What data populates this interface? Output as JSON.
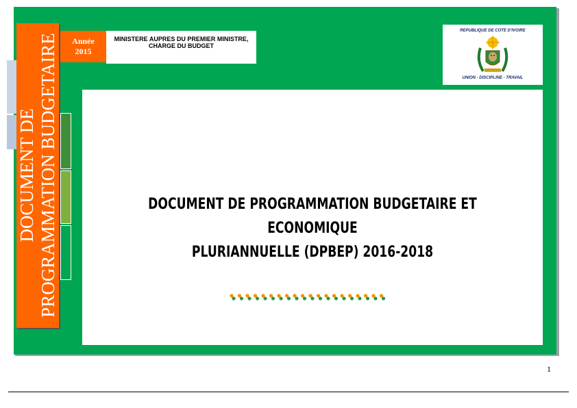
{
  "cover": {
    "vertical_title": "DOCUMENT DE PROGRAMMATION BUDGETAIRE",
    "year_label": "Année",
    "year_value": "2015",
    "ministry_line1": "MINISTERE AUPRES DU PREMIER MINISTRE,",
    "ministry_line2": "CHARGE DU BUDGET",
    "republic": "REPUBLIQUE DE COTE D'IVOIRE",
    "motto": "UNION - DISCIPLINE - TRAVAIL",
    "main_title_line1": "DOCUMENT DE PROGRAMMATION BUDGETAIRE ET ECONOMIQUE",
    "main_title_line2": "PLURIANNUELLE (DPBEP) 2016-2018",
    "page_number": "1"
  },
  "colors": {
    "frame_green": "#00a651",
    "accent_orange": "#ff6600",
    "text_dark": "#000000"
  },
  "icons": [
    "coat-of-arms-icon",
    "decorative-dots-icon"
  ]
}
